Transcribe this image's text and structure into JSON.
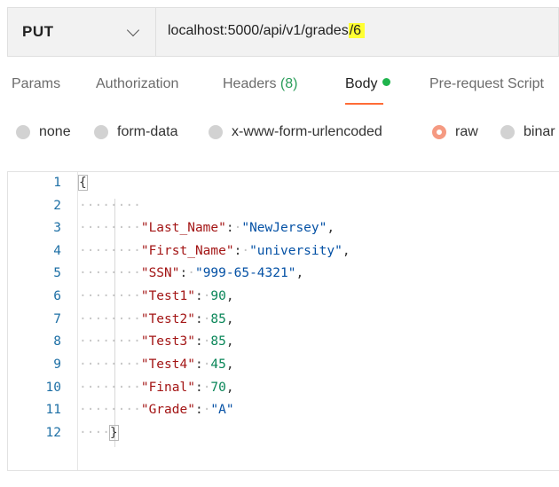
{
  "request": {
    "method": "PUT",
    "url_prefix": "localhost:5000/api/v1/grades",
    "url_highlight": "/6"
  },
  "tabs": [
    {
      "label": "Params"
    },
    {
      "label": "Authorization"
    },
    {
      "label": "Headers ",
      "count": "(8)"
    },
    {
      "label": "Body"
    },
    {
      "label": "Pre-request Script"
    }
  ],
  "body_types": [
    "none",
    "form-data",
    "x-www-form-urlencoded",
    "raw",
    "binar"
  ],
  "selected_body_type": "raw",
  "editor": {
    "line_numbers": [
      "1",
      "2",
      "3",
      "4",
      "5",
      "6",
      "7",
      "8",
      "9",
      "10",
      "11",
      "12"
    ],
    "open_brace": "{",
    "close_brace": "}",
    "fields": [
      {
        "key": "\"Last_Name\"",
        "value": "\"NewJersey\"",
        "type": "string",
        "comma": ","
      },
      {
        "key": "\"First_Name\"",
        "value": "\"university\"",
        "type": "string",
        "comma": ","
      },
      {
        "key": "\"SSN\"",
        "value": "\"999-65-4321\"",
        "type": "string",
        "comma": ","
      },
      {
        "key": "\"Test1\"",
        "value": "90",
        "type": "number",
        "comma": ","
      },
      {
        "key": "\"Test2\"",
        "value": "85",
        "type": "number",
        "comma": ","
      },
      {
        "key": "\"Test3\"",
        "value": "85",
        "type": "number",
        "comma": ","
      },
      {
        "key": "\"Test4\"",
        "value": "45",
        "type": "number",
        "comma": ","
      },
      {
        "key": "\"Final\"",
        "value": "70",
        "type": "number",
        "comma": ","
      },
      {
        "key": "\"Grade\"",
        "value": "\"A\"",
        "type": "string",
        "comma": ""
      }
    ],
    "colors": {
      "key": "#a31515",
      "string": "#0451a5",
      "number": "#098658",
      "line_number": "#1d6fa5"
    }
  },
  "accent": {
    "active_tab_underline": "#ff6c37",
    "body_dot": "#1fb44c",
    "url_highlight": "#ffff33"
  }
}
